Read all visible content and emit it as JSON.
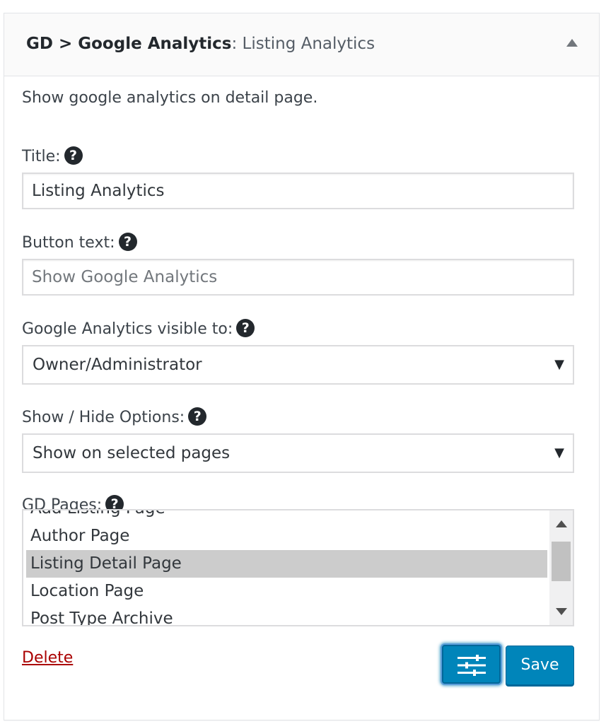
{
  "widget": {
    "title_main": "GD > Google Analytics",
    "title_sep": ": ",
    "title_sub": "Listing Analytics"
  },
  "description": "Show google analytics on detail page.",
  "fields": {
    "title": {
      "label": "Title:",
      "value": "Listing Analytics"
    },
    "button_text": {
      "label": "Button text:",
      "placeholder": "Show Google Analytics"
    },
    "visible_to": {
      "label": "Google Analytics visible to:",
      "selected": "Owner/Administrator"
    },
    "show_hide": {
      "label": "Show / Hide Options:",
      "selected": "Show on selected pages"
    },
    "gd_pages": {
      "label": "GD Pages:",
      "items": [
        "Add Listing Page",
        "Author Page",
        "Listing Detail Page",
        "Location Page",
        "Post Type Archive"
      ],
      "selected": "Listing Detail Page"
    }
  },
  "help_glyph": "?",
  "select_arrow": "▼",
  "actions": {
    "delete_label": "Delete",
    "save_label": "Save"
  },
  "colors": {
    "primary_button": "#0085ba",
    "delete_link": "#aa0000",
    "selected_row": "#cccccc"
  }
}
